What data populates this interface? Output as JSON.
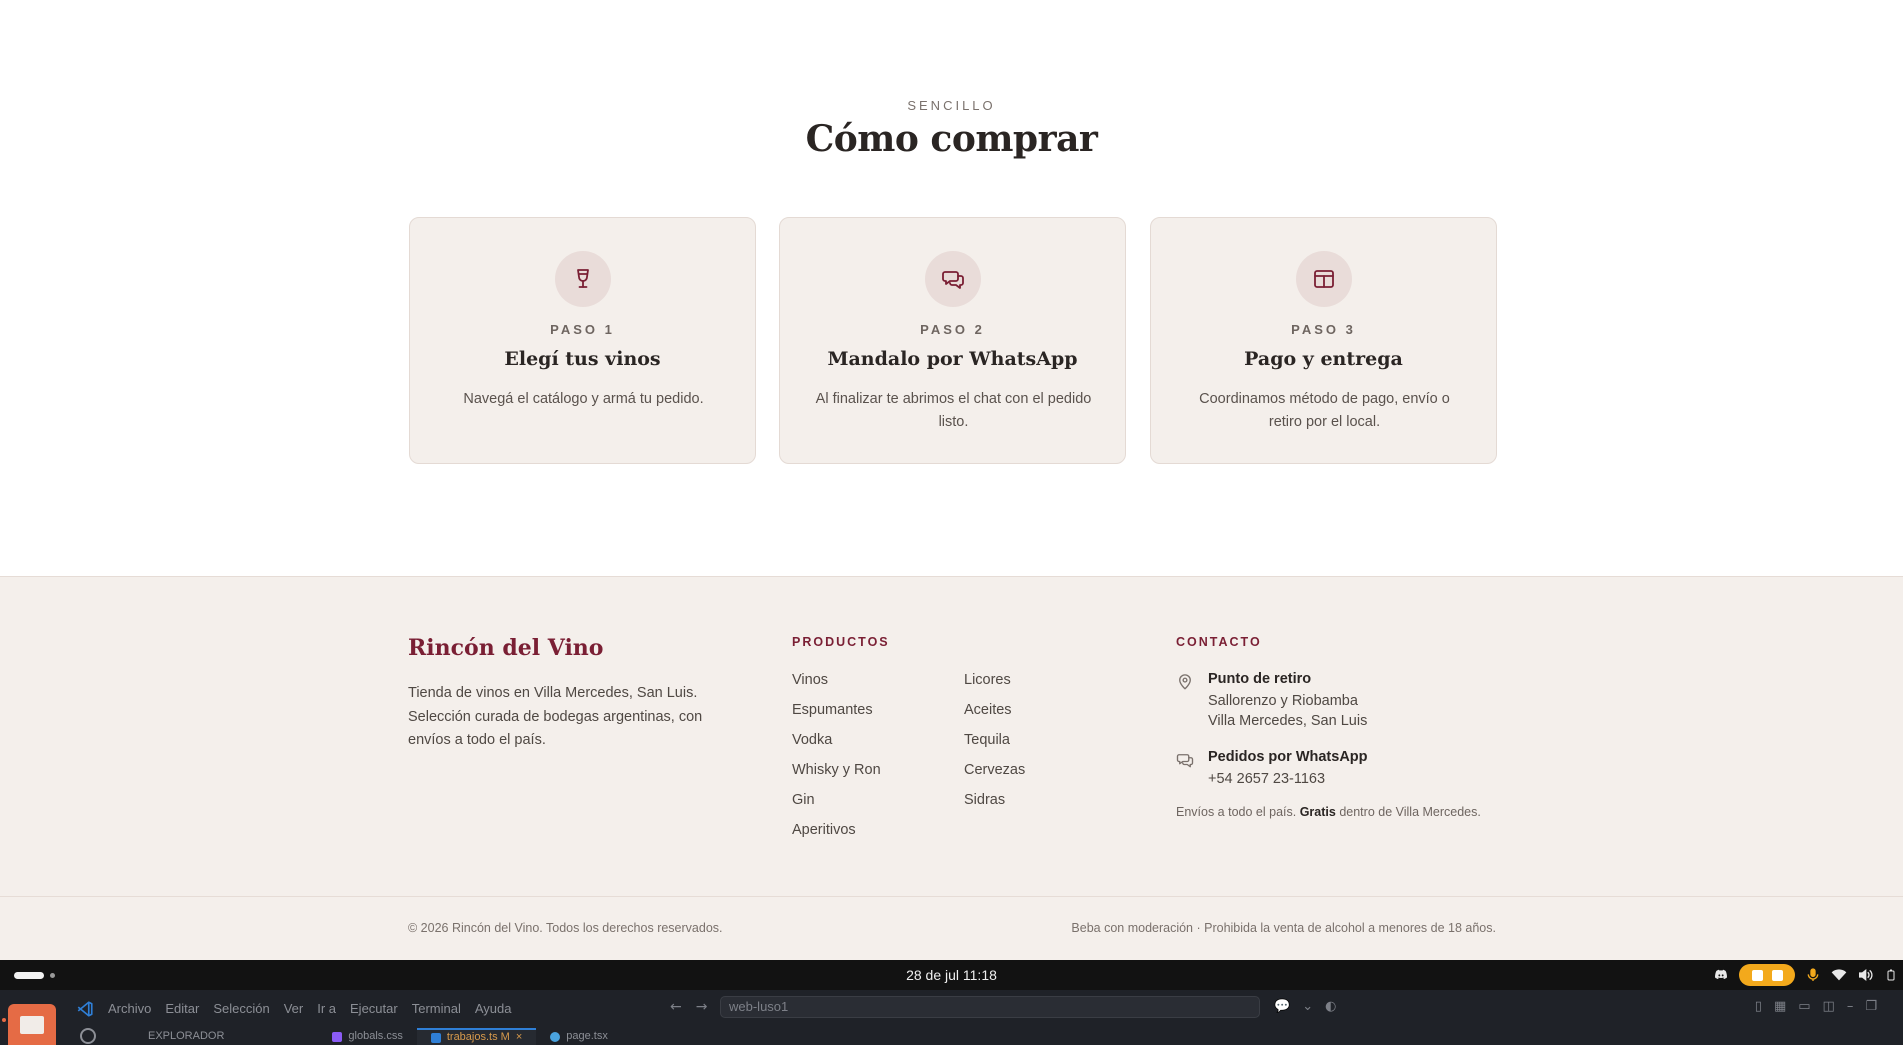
{
  "howto": {
    "eyebrow": "SENCILLO",
    "title": "Cómo comprar",
    "steps": [
      {
        "icon": "wine-glass-icon",
        "step": "PASO 1",
        "title": "Elegí tus vinos",
        "desc": "Navegá el catálogo y armá tu pedido."
      },
      {
        "icon": "chat-bubbles-icon",
        "step": "PASO 2",
        "title": "Mandalo por WhatsApp",
        "desc": "Al finalizar te abrimos el chat con el pedido listo."
      },
      {
        "icon": "package-icon",
        "step": "PASO 3",
        "title": "Pago y entrega",
        "desc": "Coordinamos método de pago, envío o retiro por el local."
      }
    ]
  },
  "footer": {
    "brand": "Rincón del Vino",
    "brand_desc": "Tienda de vinos en Villa Mercedes, San Luis. Selección curada de bodegas argentinas, con envíos a todo el país.",
    "products_heading": "PRODUCTOS",
    "products_col1": [
      "Vinos",
      "Espumantes",
      "Vodka",
      "Whisky y Ron",
      "Gin",
      "Aperitivos"
    ],
    "products_col2": [
      "Licores",
      "Aceites",
      "Tequila",
      "Cervezas",
      "Sidras"
    ],
    "contact_heading": "CONTACTO",
    "pickup_title": "Punto de retiro",
    "pickup_line1": "Sallorenzo y Riobamba",
    "pickup_line2": "Villa Mercedes, San Luis",
    "whatsapp_title": "Pedidos por WhatsApp",
    "whatsapp_number": "+54 2657 23-1163",
    "ship_prefix": "Envíos a todo el país.",
    "ship_bold": "Gratis",
    "ship_suffix": "dentro de Villa Mercedes.",
    "copyright": "© 2026 Rincón del Vino. Todos los derechos reservados.",
    "legal": "Beba con moderación · Prohibida la venta de alcohol a menores de 18 años."
  },
  "os": {
    "clock": "28 de jul  11:18"
  },
  "vscode": {
    "menu": [
      "Archivo",
      "Editar",
      "Selección",
      "Ver",
      "Ir a",
      "Ejecutar",
      "Terminal",
      "Ayuda"
    ],
    "search": "web-luso1",
    "explorer_label": "EXPLORADOR",
    "tabs": [
      "globals.css",
      "trabajos.ts  M",
      "page.tsx"
    ]
  },
  "colors": {
    "accent": "#7a1f34",
    "card_bg": "#f4efeb",
    "icon_circle": "#e9dcd9"
  }
}
